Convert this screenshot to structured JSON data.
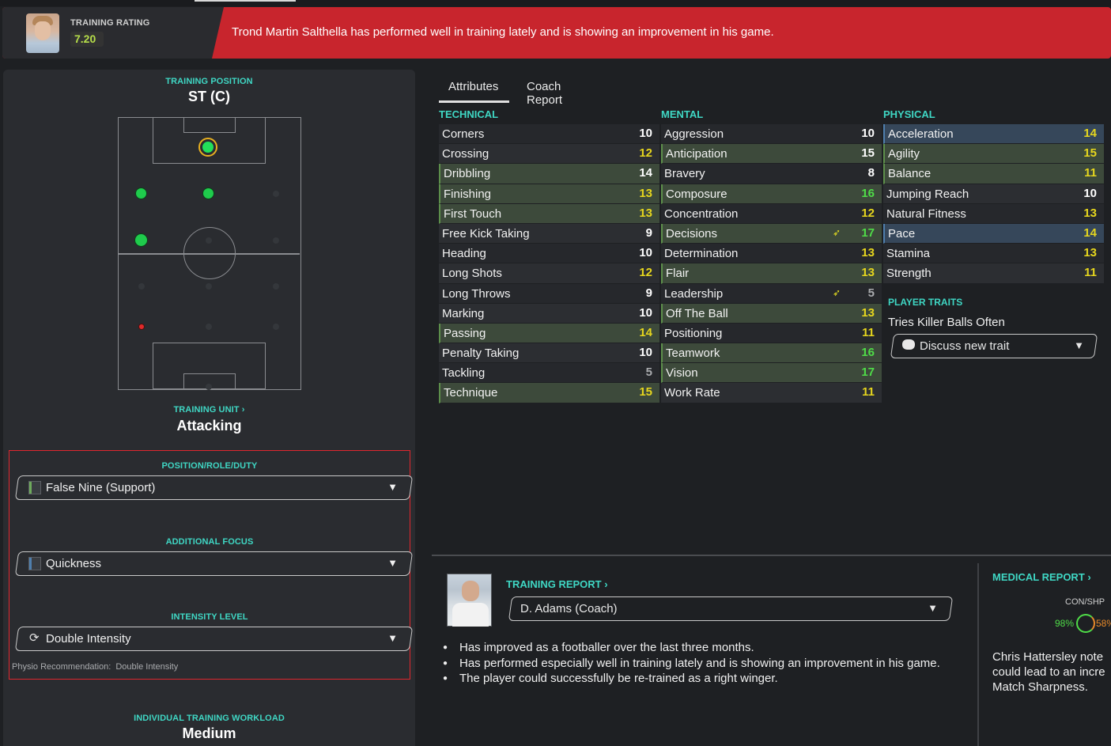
{
  "banner": {
    "rating_label": "TRAINING RATING",
    "rating_value": "7.20",
    "message": "Trond Martin Salthella has performed well in training lately and is showing an improvement in his game."
  },
  "left": {
    "training_position_label": "TRAINING POSITION",
    "training_position": "ST (C)",
    "training_unit_label": "TRAINING UNIT ›",
    "training_unit": "Attacking",
    "position_role_label": "POSITION/ROLE/DUTY",
    "position_role_value": "False Nine (Support)",
    "additional_focus_label": "ADDITIONAL FOCUS",
    "additional_focus_value": "Quickness",
    "intensity_label": "INTENSITY LEVEL",
    "intensity_value": "Double Intensity",
    "physio_label": "Physio Recommendation:",
    "physio_value": "Double Intensity",
    "workload_label": "INDIVIDUAL TRAINING WORKLOAD",
    "workload_value": "Medium"
  },
  "tabs": [
    "Attributes",
    "Coach Report"
  ],
  "attributes": {
    "technical_label": "TECHNICAL",
    "mental_label": "MENTAL",
    "physical_label": "PHYSICAL",
    "technical": [
      {
        "name": "Corners",
        "value": "10"
      },
      {
        "name": "Crossing",
        "value": "12"
      },
      {
        "name": "Dribbling",
        "value": "14"
      },
      {
        "name": "Finishing",
        "value": "13"
      },
      {
        "name": "First Touch",
        "value": "13"
      },
      {
        "name": "Free Kick Taking",
        "value": "9"
      },
      {
        "name": "Heading",
        "value": "10"
      },
      {
        "name": "Long Shots",
        "value": "12"
      },
      {
        "name": "Long Throws",
        "value": "9"
      },
      {
        "name": "Marking",
        "value": "10"
      },
      {
        "name": "Passing",
        "value": "14"
      },
      {
        "name": "Penalty Taking",
        "value": "10"
      },
      {
        "name": "Tackling",
        "value": "5"
      },
      {
        "name": "Technique",
        "value": "15"
      }
    ],
    "mental": [
      {
        "name": "Aggression",
        "value": "10"
      },
      {
        "name": "Anticipation",
        "value": "15"
      },
      {
        "name": "Bravery",
        "value": "8"
      },
      {
        "name": "Composure",
        "value": "16"
      },
      {
        "name": "Concentration",
        "value": "12"
      },
      {
        "name": "Decisions",
        "value": "17"
      },
      {
        "name": "Determination",
        "value": "13"
      },
      {
        "name": "Flair",
        "value": "13"
      },
      {
        "name": "Leadership",
        "value": "5"
      },
      {
        "name": "Off The Ball",
        "value": "13"
      },
      {
        "name": "Positioning",
        "value": "11"
      },
      {
        "name": "Teamwork",
        "value": "16"
      },
      {
        "name": "Vision",
        "value": "17"
      },
      {
        "name": "Work Rate",
        "value": "11"
      }
    ],
    "physical": [
      {
        "name": "Acceleration",
        "value": "14"
      },
      {
        "name": "Agility",
        "value": "15"
      },
      {
        "name": "Balance",
        "value": "11"
      },
      {
        "name": "Jumping Reach",
        "value": "10"
      },
      {
        "name": "Natural Fitness",
        "value": "13"
      },
      {
        "name": "Pace",
        "value": "14"
      },
      {
        "name": "Stamina",
        "value": "13"
      },
      {
        "name": "Strength",
        "value": "11"
      }
    ]
  },
  "traits": {
    "label": "PLAYER TRAITS",
    "items": [
      "Tries Killer Balls Often"
    ],
    "discuss_button": "Discuss new trait"
  },
  "training_report": {
    "label": "TRAINING REPORT ›",
    "coach": "D. Adams (Coach)",
    "bullets": [
      "Has improved as a footballer over the last three months.",
      "Has performed especially well in training lately and is showing an improvement in his game.",
      "The player could successfully be re-trained as a right winger."
    ]
  },
  "medical_report": {
    "label": "MEDICAL REPORT ›",
    "con_shp_label": "CON/SHP",
    "condition": "98%",
    "sharpness": "58%",
    "note_lines": [
      "Chris Hattersley note",
      "could lead to an incre",
      "Match Sharpness."
    ]
  },
  "colors": {
    "accent": "#3fd7c4",
    "banner": "#c8252d",
    "value_white": "#ffffff",
    "value_yellow": "#e6d61e",
    "value_green": "#4fdc48"
  }
}
